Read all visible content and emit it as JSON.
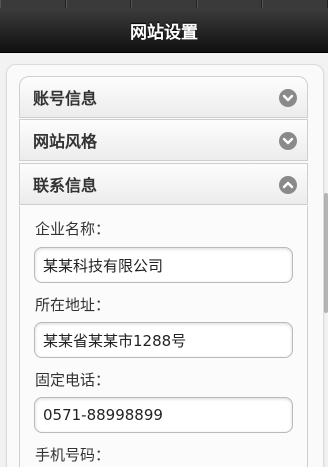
{
  "header": {
    "title": "网站设置"
  },
  "accordion": [
    {
      "label": "账号信息",
      "expanded": false
    },
    {
      "label": "网站风格",
      "expanded": false
    },
    {
      "label": "联系信息",
      "expanded": true
    }
  ],
  "contact": {
    "company_label": "企业名称：",
    "company_value": "某某科技有限公司",
    "address_label": "所在地址：",
    "address_value": "某某省某某市1288号",
    "phone_label": "固定电话：",
    "phone_value": "0571-88998899",
    "mobile_label": "手机号码："
  },
  "colors": {
    "header_bg": "#1a1a1a",
    "chevron_bg": "#8a8a8a"
  }
}
